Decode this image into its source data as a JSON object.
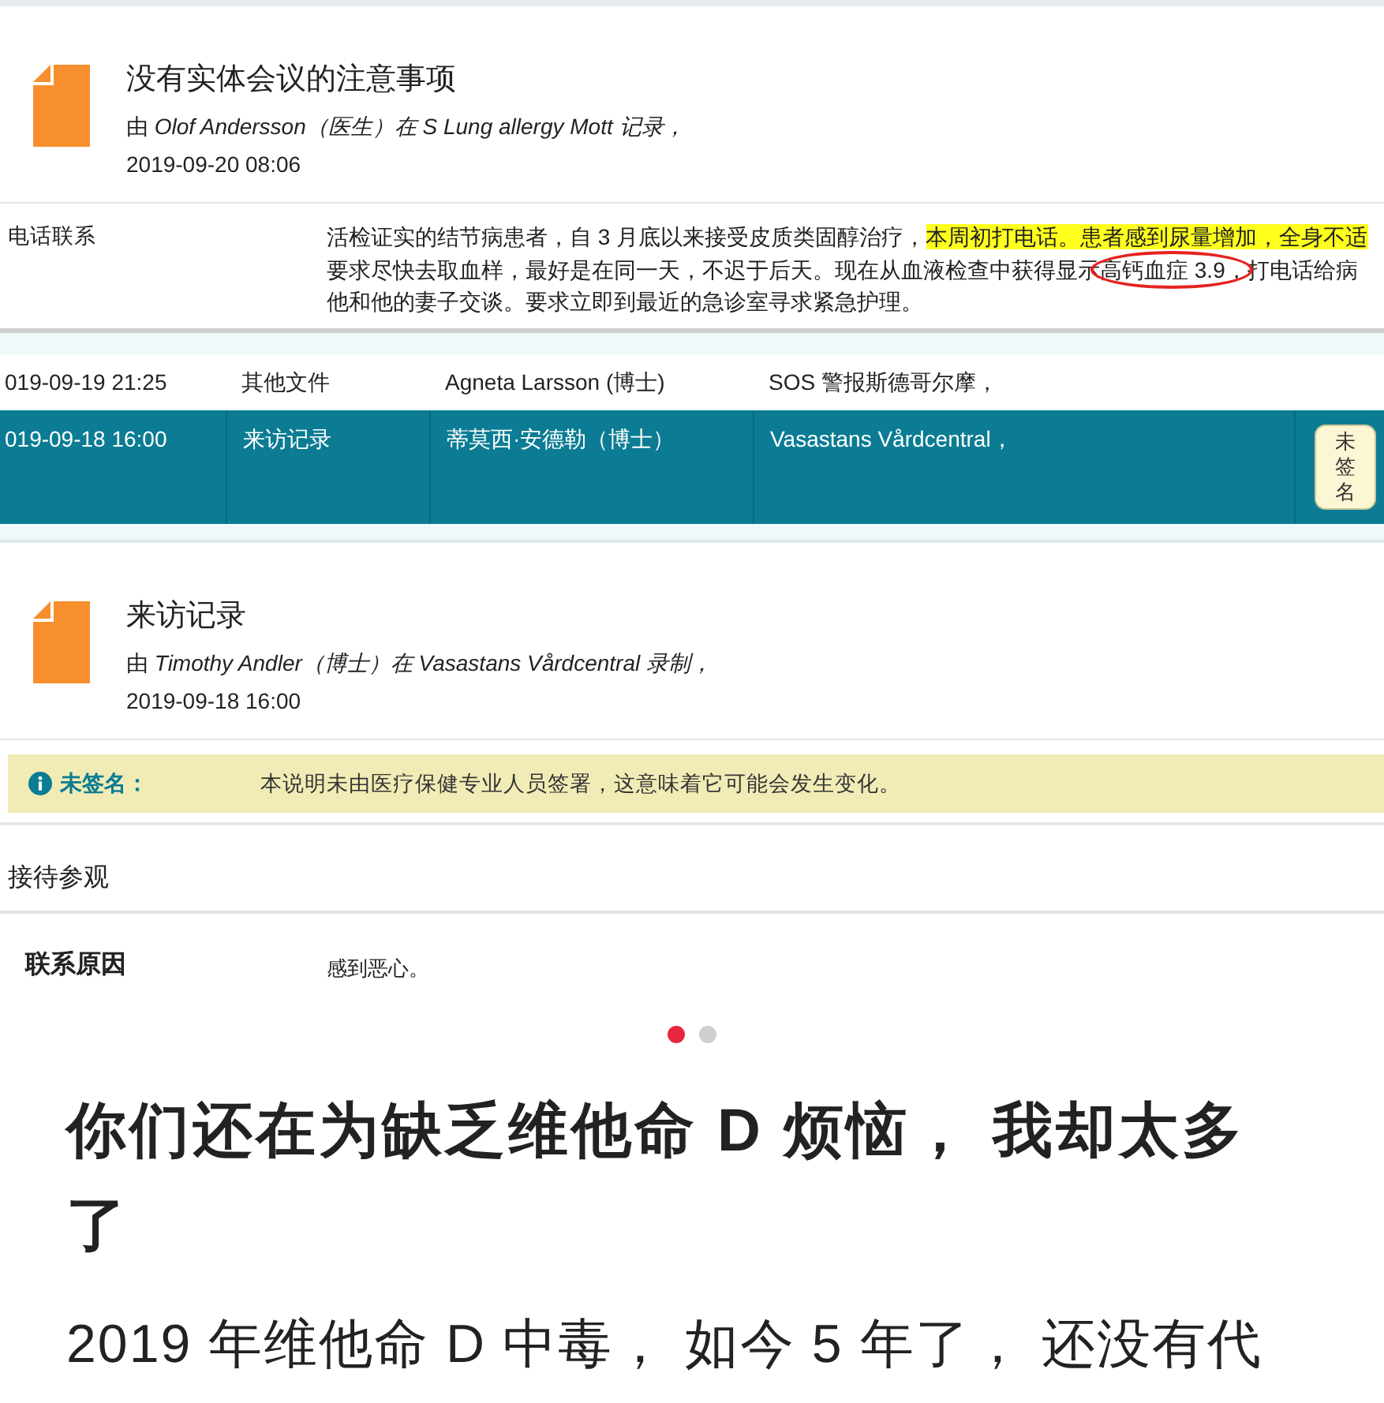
{
  "note_header": {
    "title": "没有实体会议的注意事项",
    "byline": "由 *Olof Andersson（医生）在 S Lung allergy Mott 记录，*",
    "date": "2019-09-20 08:06"
  },
  "phone_note": {
    "label": "电话联系",
    "lines": [
      {
        "segments": [
          {
            "text": "活检证实的结节病患者，自 3 月底以来接受皮质类固醇治疗，",
            "highlighted": false,
            "circled": false
          },
          {
            "text": "本周初打电话。患者感到尿量增加，全身不适",
            "highlighted": true,
            "circled": false
          }
        ]
      },
      {
        "segments": [
          {
            "text": "要求尽快去取血样，最好是在同一天，不迟于后天。现在从血液检查中获得显示",
            "highlighted": false,
            "circled": false
          },
          {
            "text": "高钙血症 3.9，",
            "highlighted": false,
            "circled": true
          },
          {
            "text": "打电话给病",
            "highlighted": false,
            "circled": false
          }
        ]
      },
      {
        "segments": [
          {
            "text": "他和他的妻子交谈。要求立即到最近的急诊室寻求紧急护理。",
            "highlighted": false,
            "circled": false
          }
        ]
      }
    ]
  },
  "journal_table": {
    "rows": [
      {
        "selected": false,
        "cells": [
          "019-09-19 21:25",
          "其他文件",
          "Agneta Larsson (博士)",
          "SOS 警报斯德哥尔摩，"
        ]
      },
      {
        "selected": true,
        "cells": [
          "019-09-18 16:00",
          "来访记录",
          "蒂莫西·安德勒（博士）",
          "Vasastans Vårdcentral，"
        ],
        "badge": "未签名"
      }
    ]
  },
  "visit_header": {
    "title": "来访记录",
    "byline": "由 *Timothy Andler（博士）在 Vasastans Vårdcentral 录制，*",
    "date": "2019-09-18 16:00"
  },
  "alert": {
    "label": "未签名：",
    "message": "本说明未由医疗保健专业人员签署，这意味着它可能会发生变化。"
  },
  "section": {
    "heading": "接待参观",
    "fields": [
      {
        "label": "联系原因",
        "value": "感到恶心。"
      }
    ]
  },
  "carousel": {
    "dots": [
      {
        "selected": true
      },
      {
        "selected": false
      }
    ]
  },
  "article": {
    "headline": "你们还在为缺乏维他命 D 烦恼， 我却太多了",
    "subtitle": "2019 年维他命 D 中毒， 如今 5 年了， 还没有代"
  }
}
